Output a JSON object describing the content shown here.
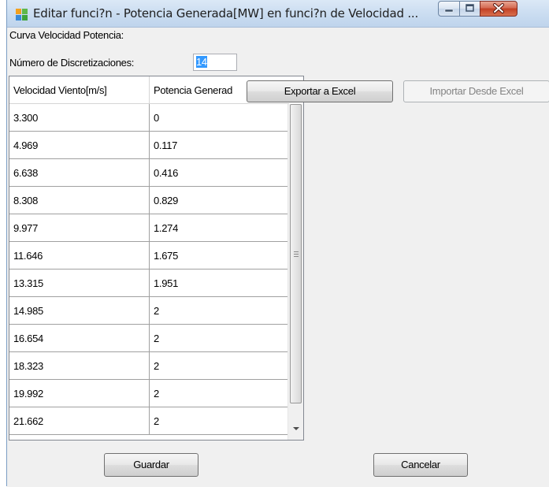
{
  "window": {
    "title": "Editar funci?n - Potencia Generada[MW] en funci?n de Velocidad ..."
  },
  "form": {
    "curve_label": "Curva Velocidad Potencia:",
    "discretizations_label": "Número de Discretizaciones:",
    "discretizations_value": "14"
  },
  "grid": {
    "columns": [
      "Velocidad Viento[m/s]",
      "Potencia Generad"
    ],
    "rows": [
      [
        "3.300",
        "0"
      ],
      [
        "4.969",
        "0.117"
      ],
      [
        "6.638",
        "0.416"
      ],
      [
        "8.308",
        "0.829"
      ],
      [
        "9.977",
        "1.274"
      ],
      [
        "11.646",
        "1.675"
      ],
      [
        "13.315",
        "1.951"
      ],
      [
        "14.985",
        "2"
      ],
      [
        "16.654",
        "2"
      ],
      [
        "18.323",
        "2"
      ],
      [
        "19.992",
        "2"
      ],
      [
        "21.662",
        "2"
      ]
    ]
  },
  "buttons": {
    "export": "Exportar a Excel",
    "import": "Importar Desde Excel",
    "save": "Guardar",
    "cancel": "Cancelar"
  },
  "colors": {
    "selection": "#3399ff",
    "close_button": "#c23f24"
  },
  "icons": {
    "app": "app-icon",
    "minimize": "minimize-icon",
    "maximize": "maximize-icon",
    "close": "close-icon"
  }
}
